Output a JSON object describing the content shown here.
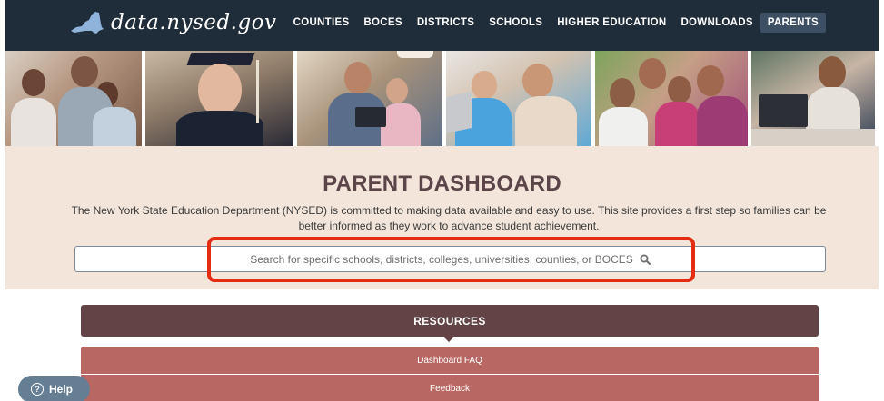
{
  "brand": {
    "logo_text": "data.nysed.gov"
  },
  "nav": {
    "items": [
      {
        "label": "COUNTIES"
      },
      {
        "label": "BOCES"
      },
      {
        "label": "DISTRICTS"
      },
      {
        "label": "SCHOOLS"
      },
      {
        "label": "HIGHER EDUCATION"
      },
      {
        "label": "DOWNLOADS"
      },
      {
        "label": "PARENTS",
        "active": true
      }
    ]
  },
  "hero": {
    "title": "PARENT DASHBOARD",
    "description": "The New York State Education Department (NYSED) is committed to making data available and easy to use. This site provides a first step so families can be better informed as they work to advance student achievement.",
    "search_placeholder": "Search for specific schools, districts, colleges, universities, counties, or BOCES"
  },
  "resources": {
    "title": "RESOURCES",
    "items": [
      {
        "label": "Dashboard FAQ"
      },
      {
        "label": "Feedback"
      }
    ]
  },
  "help": {
    "label": "Help",
    "icon": "question-circle-icon"
  },
  "colors": {
    "nav_bg": "#1f2d3a",
    "hero_bg": "#f3e5d9",
    "resources_header": "#644347",
    "resources_item": "#b96763",
    "highlight": "#e42c12",
    "help_bg": "#667e94"
  }
}
